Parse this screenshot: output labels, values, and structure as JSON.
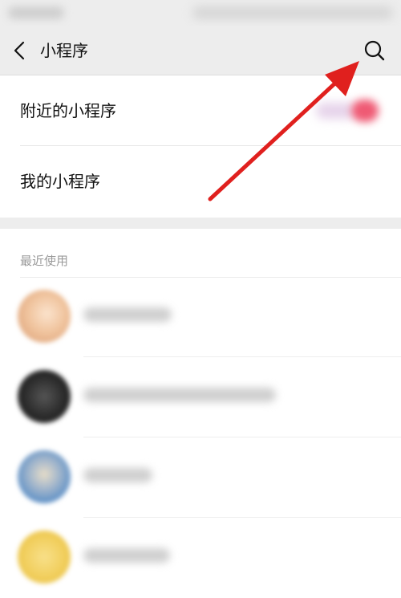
{
  "header": {
    "title": "小程序",
    "back_icon": "chevron-left-icon",
    "search_icon": "search-icon"
  },
  "menu": {
    "items": [
      {
        "label": "附近的小程序"
      },
      {
        "label": "我的小程序"
      }
    ]
  },
  "recent": {
    "title": "最近使用",
    "apps": [
      {
        "avatar_color": "#f0c49e"
      },
      {
        "avatar_color": "#2a2a2a"
      },
      {
        "avatar_color": "#5a8ec6"
      },
      {
        "avatar_color": "#f1ce5c"
      }
    ]
  },
  "colors": {
    "header_bg": "#ededed",
    "annotation_arrow": "#e0201e",
    "section_title": "#9a9a9a"
  }
}
